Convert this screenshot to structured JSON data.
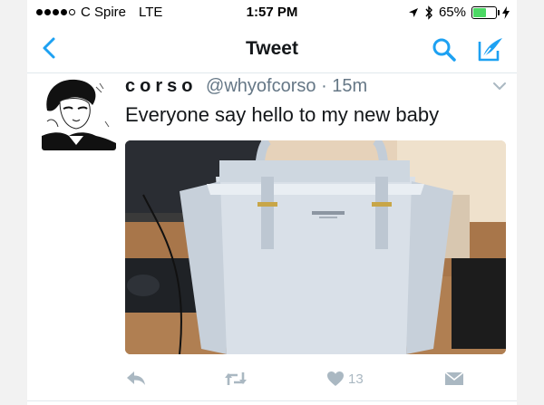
{
  "status_bar": {
    "carrier": "C Spire",
    "network": "LTE",
    "time": "1:57 PM",
    "battery": "65%",
    "battery_level": 0.65
  },
  "nav": {
    "title": "Tweet"
  },
  "tweet": {
    "display_name": "corso",
    "handle": "@whyofcorso",
    "separator": "·",
    "time_ago": "15m",
    "text": "Everyone say hello to my new baby",
    "like_count": "13"
  },
  "colors": {
    "twitter_blue": "#1da1f2",
    "action_gray": "#aab8c2",
    "secondary_text": "#657786",
    "battery_green": "#4cd964"
  },
  "icons": [
    "back-chevron-icon",
    "search-icon",
    "compose-icon",
    "caret-down-icon",
    "reply-icon",
    "retweet-icon",
    "heart-icon",
    "message-icon",
    "location-arrow-icon",
    "bluetooth-icon",
    "charging-icon"
  ]
}
